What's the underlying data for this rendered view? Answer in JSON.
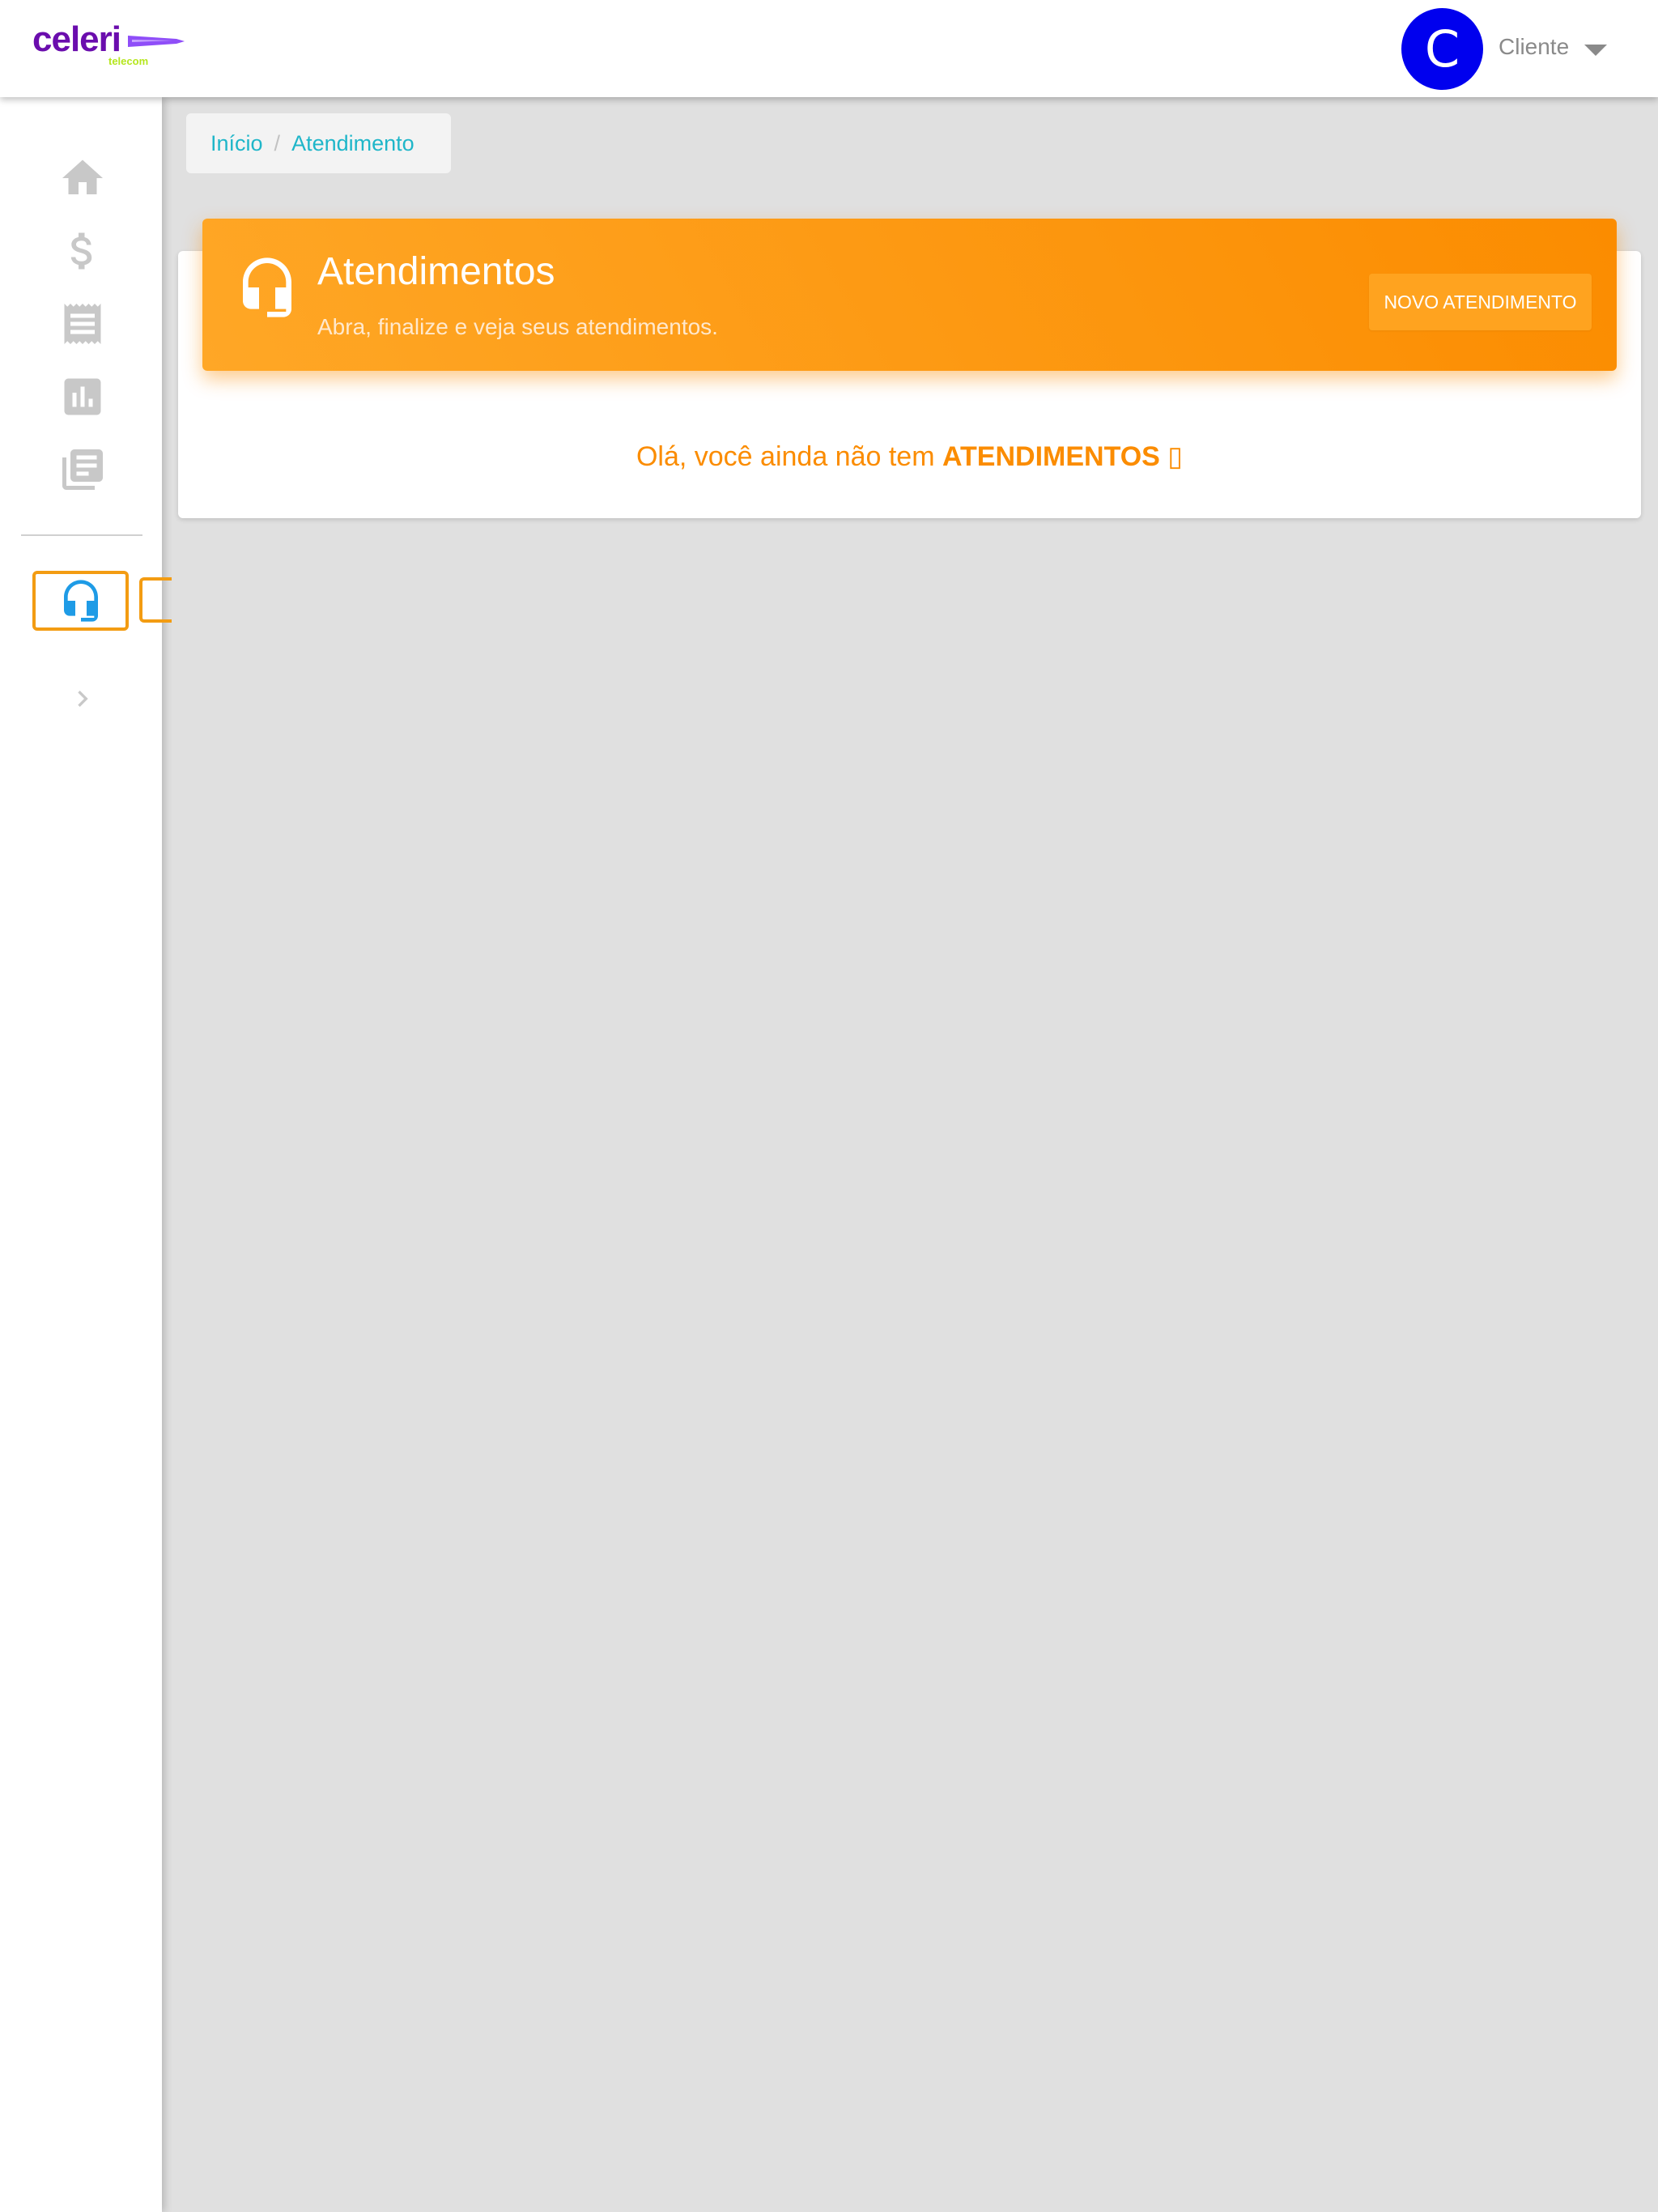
{
  "header": {
    "logo_text": "celeri",
    "logo_subtext": "telecom",
    "avatar_initial": "C",
    "user_name": "Cliente"
  },
  "sidebar": {
    "items": [
      {
        "icon": "home-icon"
      },
      {
        "icon": "dollar-icon"
      },
      {
        "icon": "receipt-icon"
      },
      {
        "icon": "bar-chart-icon"
      },
      {
        "icon": "library-books-icon"
      },
      {
        "icon": "headset-icon",
        "active": true
      },
      {
        "icon": "chevron-right-icon"
      }
    ]
  },
  "breadcrumb": {
    "home": "Início",
    "separator": "/",
    "current": "Atendimento"
  },
  "banner": {
    "title": "Atendimentos",
    "subtitle": "Abra, finalize e veja seus atendimentos.",
    "button_label": "NOVO ATENDIMENTO"
  },
  "empty_state": {
    "prefix": "Olá, você ainda não tem ",
    "highlight": "ATENDIMENTOS",
    "suffix": " ▯"
  },
  "colors": {
    "accent_orange": "#fb8c00",
    "link_teal": "#1fb6c9",
    "avatar_blue": "#0000ee",
    "active_icon_blue": "#1e9be6",
    "brand_purple": "#6a0dad"
  }
}
